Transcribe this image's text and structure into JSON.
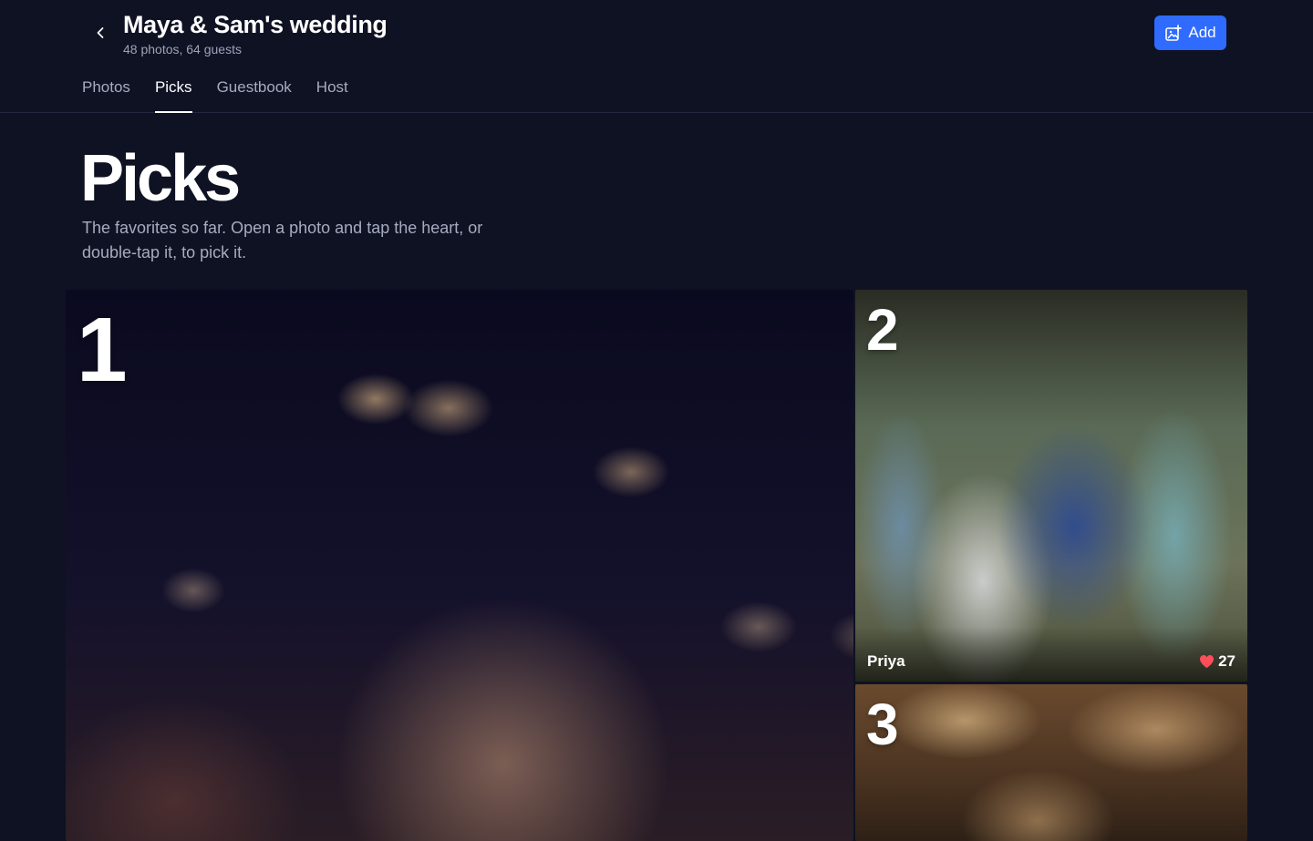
{
  "header": {
    "title": "Maya & Sam's wedding",
    "meta": "48 photos, 64 guests",
    "add_label": "Add",
    "back_icon": "chevron-left-icon",
    "add_icon": "add-photo-icon"
  },
  "tabs": [
    {
      "label": "Photos",
      "active": false
    },
    {
      "label": "Picks",
      "active": true
    },
    {
      "label": "Guestbook",
      "active": false
    },
    {
      "label": "Host",
      "active": false
    }
  ],
  "page": {
    "heading": "Picks",
    "subtitle": "The favorites so far. Open a photo and tap the heart, or double-tap it, to pick it."
  },
  "picks": [
    {
      "rank": "1"
    },
    {
      "rank": "2",
      "uploader": "Priya",
      "likes": "27"
    },
    {
      "rank": "3"
    }
  ],
  "colors": {
    "background": "#0e1223",
    "accent": "#2f6bff",
    "heart": "#ff4d5a"
  }
}
